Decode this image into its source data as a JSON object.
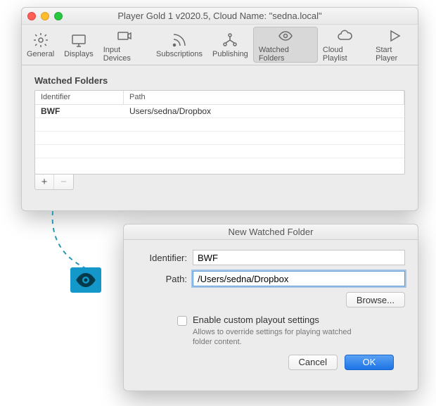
{
  "window1": {
    "title": "Player Gold 1 v2020.5, Cloud Name: \"sedna.local\"",
    "toolbar": [
      {
        "id": "general",
        "label": "General"
      },
      {
        "id": "displays",
        "label": "Displays"
      },
      {
        "id": "inputdevices",
        "label": "Input Devices"
      },
      {
        "id": "subscriptions",
        "label": "Subscriptions"
      },
      {
        "id": "publishing",
        "label": "Publishing"
      },
      {
        "id": "watched",
        "label": "Watched Folders"
      },
      {
        "id": "cloud",
        "label": "Cloud Playlist"
      },
      {
        "id": "start",
        "label": "Start Player"
      }
    ],
    "section_title": "Watched Folders",
    "columns": {
      "c1": "Identifier",
      "c2": "Path"
    },
    "rows": [
      {
        "id": "BWF",
        "path": "Users/sedna/Dropbox"
      }
    ],
    "add_label": "+",
    "remove_label": "−"
  },
  "window2": {
    "title": "New Watched Folder",
    "identifier_label": "Identifier:",
    "identifier_value": "BWF",
    "path_label": "Path:",
    "path_value": "/Users/sedna/Dropbox",
    "browse_label": "Browse...",
    "enable_label": "Enable custom playout settings",
    "enable_sub": "Allows to override settings for playing watched folder content.",
    "cancel_label": "Cancel",
    "ok_label": "OK"
  }
}
